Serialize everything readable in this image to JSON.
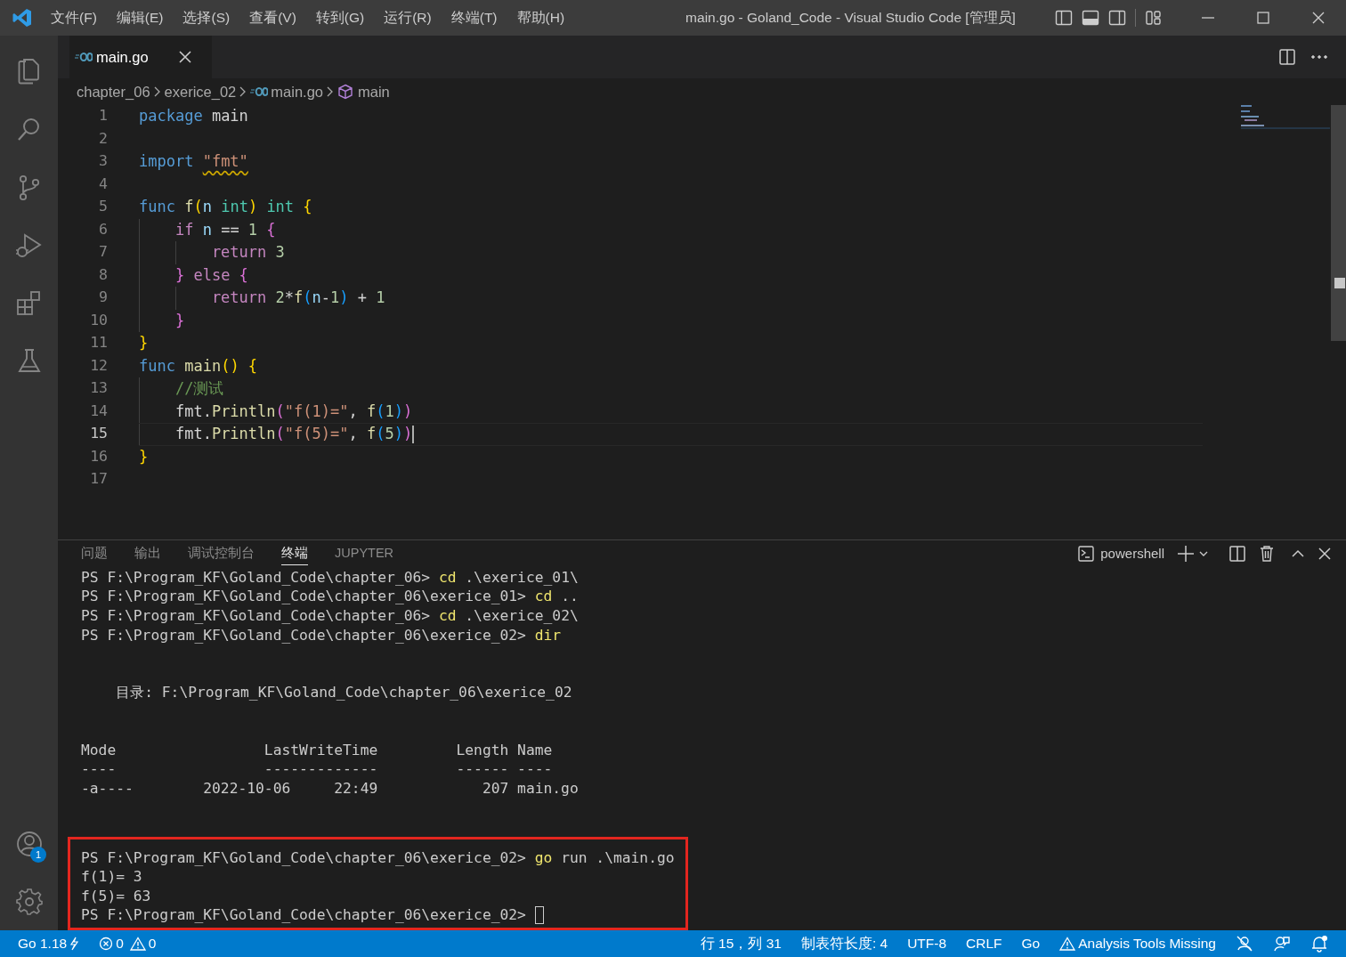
{
  "title_bar": {
    "menu": [
      "文件(F)",
      "编辑(E)",
      "选择(S)",
      "查看(V)",
      "转到(G)",
      "运行(R)",
      "终端(T)",
      "帮助(H)"
    ],
    "title": "main.go - Goland_Code - Visual Studio Code [管理员]"
  },
  "activity_bar": {
    "top": [
      {
        "kind": "files"
      },
      {
        "kind": "search"
      },
      {
        "kind": "source_control"
      },
      {
        "kind": "run_debug"
      },
      {
        "kind": "extensions"
      },
      {
        "kind": "testing"
      }
    ],
    "bottom": [
      {
        "kind": "account",
        "badge": "1"
      },
      {
        "kind": "settings"
      }
    ]
  },
  "editor": {
    "tabs": [
      {
        "label": "main.go",
        "selected": true
      }
    ],
    "breadcrumbs": [
      {
        "label": "chapter_06",
        "kind": "folder"
      },
      {
        "label": "exerice_02",
        "kind": "folder"
      },
      {
        "label": "main.go",
        "kind": "go_file"
      },
      {
        "label": "main",
        "kind": "symbol"
      }
    ],
    "lines": [
      {
        "number": "1",
        "current": false,
        "tokens": [
          {
            "text": "package ",
            "kind": "kw"
          },
          {
            "text": "main",
            "kind": "plain"
          }
        ]
      },
      {
        "number": "2",
        "current": false
      },
      {
        "number": "3",
        "current": false,
        "tokens": [
          {
            "text": "import ",
            "kind": "kw"
          },
          {
            "text": "\"fmt\"",
            "kind": "str_warn"
          }
        ]
      },
      {
        "number": "4",
        "current": false
      },
      {
        "number": "5",
        "current": false,
        "tokens": [
          {
            "text": "func ",
            "kind": "kw"
          },
          {
            "text": "f",
            "kind": "fn"
          },
          {
            "text": "(",
            "kind": "b1"
          },
          {
            "text": "n ",
            "kind": "var"
          },
          {
            "text": "int",
            "kind": "type"
          },
          {
            "text": ")",
            "kind": "b1"
          },
          {
            "text": " int ",
            "kind": "type"
          },
          {
            "text": "{",
            "kind": "b1"
          }
        ]
      },
      {
        "number": "6",
        "current": false,
        "tokens": [
          {
            "text": "    if ",
            "kind": "ctrl"
          },
          {
            "text": "n",
            "kind": "var"
          },
          {
            "text": " == ",
            "kind": "plain"
          },
          {
            "text": "1 ",
            "kind": "num"
          },
          {
            "text": "{",
            "kind": "b2"
          }
        ]
      },
      {
        "number": "7",
        "current": false,
        "tokens": [
          {
            "text": "        return ",
            "kind": "ctrl"
          },
          {
            "text": "3",
            "kind": "num"
          }
        ]
      },
      {
        "number": "8",
        "current": false,
        "tokens": [
          {
            "text": "    } ",
            "kind": "b2"
          },
          {
            "text": "else ",
            "kind": "ctrl"
          },
          {
            "text": "{",
            "kind": "b2"
          }
        ]
      },
      {
        "number": "9",
        "current": false,
        "tokens": [
          {
            "text": "        return ",
            "kind": "ctrl"
          },
          {
            "text": "2",
            "kind": "num"
          },
          {
            "text": "*",
            "kind": "plain"
          },
          {
            "text": "f",
            "kind": "fn"
          },
          {
            "text": "(",
            "kind": "b3"
          },
          {
            "text": "n",
            "kind": "var"
          },
          {
            "text": "-",
            "kind": "plain"
          },
          {
            "text": "1",
            "kind": "num"
          },
          {
            "text": ")",
            "kind": "b3"
          },
          {
            "text": " + ",
            "kind": "plain"
          },
          {
            "text": "1",
            "kind": "num"
          }
        ]
      },
      {
        "number": "10",
        "current": false,
        "tokens": [
          {
            "text": "    }",
            "kind": "b2"
          }
        ]
      },
      {
        "number": "11",
        "current": false,
        "tokens": [
          {
            "text": "}",
            "kind": "b1"
          }
        ]
      },
      {
        "number": "12",
        "current": false,
        "tokens": [
          {
            "text": "func ",
            "kind": "kw"
          },
          {
            "text": "main",
            "kind": "fn"
          },
          {
            "text": "()",
            "kind": "b1"
          },
          {
            "text": " {",
            "kind": "b1"
          }
        ]
      },
      {
        "number": "13",
        "current": false,
        "tokens": [
          {
            "text": "    //测试",
            "kind": "comment"
          }
        ]
      },
      {
        "number": "14",
        "current": false,
        "tokens": [
          {
            "text": "    fmt.",
            "kind": "plain"
          },
          {
            "text": "Println",
            "kind": "fn"
          },
          {
            "text": "(",
            "kind": "b2"
          },
          {
            "text": "\"f(1)=\"",
            "kind": "str"
          },
          {
            "text": ", ",
            "kind": "plain"
          },
          {
            "text": "f",
            "kind": "fn"
          },
          {
            "text": "(",
            "kind": "b3"
          },
          {
            "text": "1",
            "kind": "num"
          },
          {
            "text": ")",
            "kind": "b3"
          },
          {
            "text": ")",
            "kind": "b2"
          }
        ]
      },
      {
        "number": "15",
        "current": true,
        "tokens": [
          {
            "text": "    fmt.",
            "kind": "plain"
          },
          {
            "text": "Println",
            "kind": "fn"
          },
          {
            "text": "(",
            "kind": "b2"
          },
          {
            "text": "\"f(5)=\"",
            "kind": "str"
          },
          {
            "text": ", ",
            "kind": "plain"
          },
          {
            "text": "f",
            "kind": "fn"
          },
          {
            "text": "(",
            "kind": "b3"
          },
          {
            "text": "5",
            "kind": "num"
          },
          {
            "text": ")",
            "kind": "b3"
          },
          {
            "text": ")",
            "kind": "b2"
          }
        ]
      },
      {
        "number": "16",
        "current": false,
        "tokens": [
          {
            "text": "}",
            "kind": "b1"
          }
        ]
      },
      {
        "number": "17",
        "current": false
      }
    ]
  },
  "panel": {
    "tabs": [
      {
        "label": "问题",
        "selected": false
      },
      {
        "label": "输出",
        "selected": false
      },
      {
        "label": "调试控制台",
        "selected": false
      },
      {
        "label": "终端",
        "selected": true
      },
      {
        "label": "JUPYTER",
        "selected": false
      }
    ],
    "terminal_name": "powershell",
    "blocks": [
      {
        "highlighted": false,
        "lines": [
          [
            {
              "text": "PS F:\\Program_KF\\Goland_Code\\chapter_06> ",
              "kind": "text"
            },
            {
              "text": "cd",
              "kind": "cmd"
            },
            {
              "text": " .\\exerice_01\\",
              "kind": "text"
            }
          ],
          [
            {
              "text": "PS F:\\Program_KF\\Goland_Code\\chapter_06\\exerice_01> ",
              "kind": "text"
            },
            {
              "text": "cd",
              "kind": "cmd"
            },
            {
              "text": " ..",
              "kind": "text"
            }
          ],
          [
            {
              "text": "PS F:\\Program_KF\\Goland_Code\\chapter_06> ",
              "kind": "text"
            },
            {
              "text": "cd",
              "kind": "cmd"
            },
            {
              "text": " .\\exerice_02\\",
              "kind": "text"
            }
          ],
          [
            {
              "text": "PS F:\\Program_KF\\Goland_Code\\chapter_06\\exerice_02> ",
              "kind": "text"
            },
            {
              "text": "dir",
              "kind": "cmd"
            }
          ]
        ]
      },
      {
        "highlighted": false,
        "lines": [
          [
            {
              "text": "    目录: F:\\Program_KF\\Goland_Code\\chapter_06\\exerice_02",
              "kind": "text"
            }
          ]
        ]
      },
      {
        "highlighted": false,
        "lines": [
          [
            {
              "text": "Mode                 LastWriteTime         Length Name",
              "kind": "text"
            }
          ],
          [
            {
              "text": "----                 -------------         ------ ----",
              "kind": "text"
            }
          ],
          [
            {
              "text": "-a----        2022-10-06     22:49            207 main.go",
              "kind": "text"
            }
          ]
        ]
      },
      {
        "highlighted": true,
        "lines": [
          [
            {
              "text": "PS F:\\Program_KF\\Goland_Code\\chapter_06\\exerice_02> ",
              "kind": "text"
            },
            {
              "text": "go",
              "kind": "cmd"
            },
            {
              "text": " run .\\main.go",
              "kind": "text"
            }
          ],
          [
            {
              "text": "f(1)= 3",
              "kind": "text"
            }
          ],
          [
            {
              "text": "f(5)= 63",
              "kind": "text"
            }
          ],
          [
            {
              "text": "PS F:\\Program_KF\\Goland_Code\\chapter_06\\exerice_02> ",
              "kind": "text"
            }
          ]
        ]
      }
    ],
    "cursor_visible": true
  },
  "status_bar": {
    "left": [
      {
        "kind": "go_version",
        "label": "Go 1.18"
      },
      {
        "kind": "problems",
        "errors": "0",
        "warnings": "0"
      }
    ],
    "right": [
      {
        "kind": "text",
        "label": "行 15，列 31"
      },
      {
        "kind": "text",
        "label": "制表符长度: 4"
      },
      {
        "kind": "text",
        "label": "UTF-8"
      },
      {
        "kind": "text",
        "label": "CRLF"
      },
      {
        "kind": "text",
        "label": "Go"
      },
      {
        "kind": "warning",
        "label": "Analysis Tools Missing"
      }
    ]
  }
}
